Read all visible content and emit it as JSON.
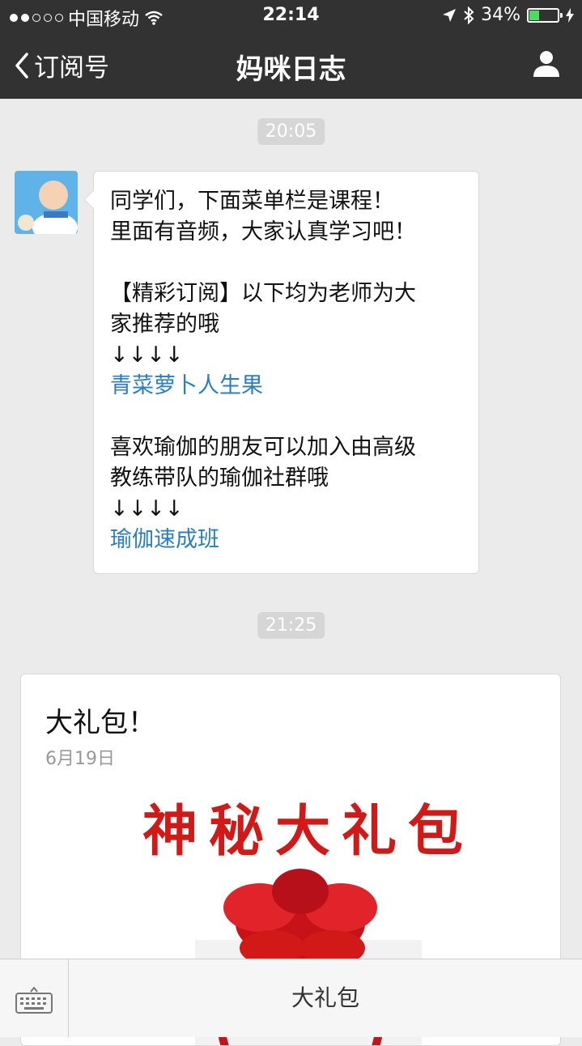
{
  "status_bar": {
    "carrier": "中国移动",
    "time": "22:14",
    "battery": "34%",
    "battery_level": 0.34
  },
  "nav": {
    "back_label": "订阅号",
    "title": "妈咪日志"
  },
  "messages": [
    {
      "timestamp": "20:05",
      "lines": [
        "同学们，下面菜单栏是课程！",
        "里面有音频，大家认真学习吧！",
        "",
        "【精彩订阅】以下均为老师为大",
        "家推荐的哦",
        "↓↓↓↓",
        "青菜萝卜人生果",
        "",
        "喜欢瑜伽的朋友可以加入由高级",
        "教练带队的瑜伽社群哦",
        "↓↓↓↓",
        "瑜伽速成班"
      ]
    },
    {
      "timestamp": "21:25",
      "card": {
        "title": "大礼包！",
        "date": "6月19日",
        "image_text": "神秘大礼包"
      }
    }
  ],
  "bottom_bar": {
    "menu_label": "大礼包"
  },
  "colors": {
    "header_bg": "#323232",
    "link": "#2a7fc1",
    "chat_bg": "#ebebeb",
    "gift_red": "#d11a17"
  },
  "icons": [
    "back-chevron-icon",
    "person-icon",
    "keyboard-icon",
    "wifi-icon",
    "location-arrow-icon",
    "bluetooth-icon",
    "battery-icon"
  ]
}
